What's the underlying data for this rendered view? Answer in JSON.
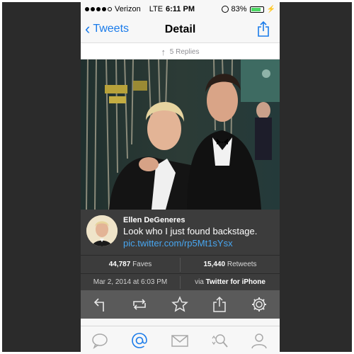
{
  "status_bar": {
    "carrier": "Verizon",
    "network": "LTE",
    "time": "6:11 PM",
    "battery": "83%",
    "battery_level": 0.83
  },
  "nav": {
    "back_label": "Tweets",
    "title": "Detail"
  },
  "replies_label": "5 Replies",
  "tweet": {
    "author": "Ellen DeGeneres",
    "text": "Look who I just found backstage.",
    "link": "pic.twitter.com/rp5Mt1sYsx"
  },
  "stats": {
    "faves_count": "44,787",
    "faves_label": "Faves",
    "retweets_count": "15,440",
    "retweets_label": "Retweets"
  },
  "meta": {
    "date": "Mar 2, 2014 at 6:03 PM",
    "via_prefix": "via",
    "client": "Twitter for iPhone"
  },
  "actions": [
    "reply-icon",
    "retweet-icon",
    "favorite-star-icon",
    "share-icon",
    "settings-gear-icon"
  ],
  "tabs": [
    "timeline-bubble-icon",
    "mentions-at-icon",
    "messages-envelope-icon",
    "search-magnifier-icon",
    "profile-person-icon"
  ],
  "colors": {
    "accent": "#1a7bea",
    "link": "#48a6f0",
    "card_bg": "#3c3c3c",
    "action_bar_bg": "#5a5a5a"
  }
}
